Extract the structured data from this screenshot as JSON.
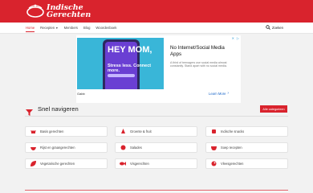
{
  "header": {
    "logo_line1": "Indische",
    "logo_line2": "Gerechten",
    "brand_color": "#d9232d"
  },
  "nav": {
    "items": [
      {
        "label": "Home",
        "active": true
      },
      {
        "label": "Recepten",
        "has_dropdown": true
      },
      {
        "label": "Members"
      },
      {
        "label": "Blog"
      },
      {
        "label": "Woordenboek"
      }
    ],
    "search_label": "Zoeken"
  },
  "ad": {
    "image_headline": "HEY MOM,",
    "image_sub": "Stress less. Connect more.",
    "headline": "No Internet/Social Media Apps",
    "description": "A third of teenagers use social media almost constantly. Stand apart with no social media.",
    "brand": "Gabb",
    "cta": "Learn More"
  },
  "section": {
    "title": "Snel navigeren",
    "button": "Alle categorieen"
  },
  "categories": [
    {
      "label": "Basis gerechten",
      "icon": "pot-icon"
    },
    {
      "label": "Groente & fruit",
      "icon": "fruit-icon"
    },
    {
      "label": "Indische snacks",
      "icon": "snack-icon"
    },
    {
      "label": "Rijst en graangerechten",
      "icon": "rice-bowl-icon"
    },
    {
      "label": "Salades",
      "icon": "salad-icon"
    },
    {
      "label": "Soep recepten",
      "icon": "soup-icon"
    },
    {
      "label": "Vegetarische gerechten",
      "icon": "leaf-icon"
    },
    {
      "label": "Visgerechten",
      "icon": "fish-icon"
    },
    {
      "label": "Vleesgerechten",
      "icon": "meat-icon"
    }
  ]
}
